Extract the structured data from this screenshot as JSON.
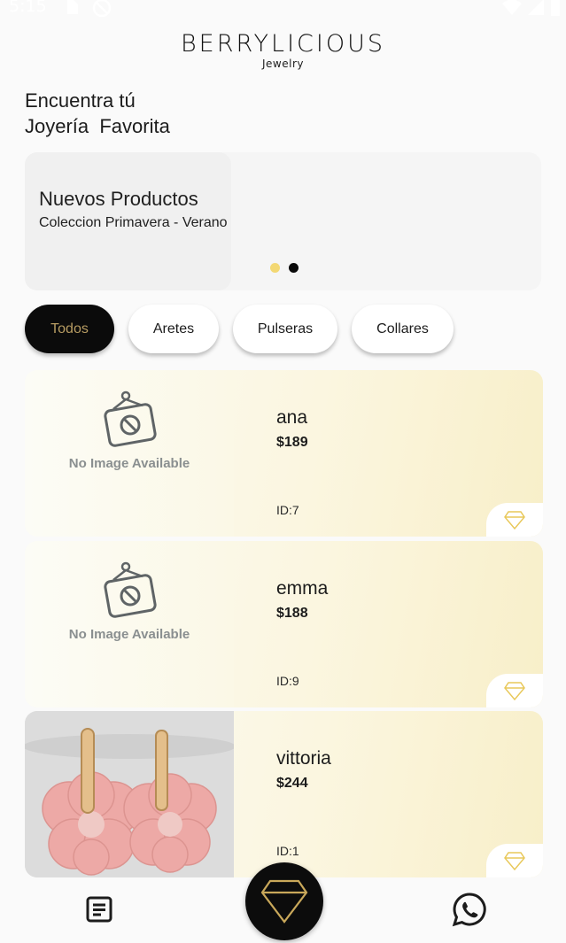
{
  "status": {
    "time": "5:15"
  },
  "brand": {
    "name": "BERRYLICIOUS",
    "sub": "Jewelry"
  },
  "headline": {
    "line1": "Encuentra tú",
    "line2": "Joyería  Favorita"
  },
  "banner": {
    "title": "Nuevos Productos",
    "subtitle": "Coleccion Primavera - Verano",
    "dots": {
      "active_color": "#f3d873",
      "inactive_color": "#0a0a0a"
    }
  },
  "categories": [
    {
      "label": "Todos",
      "active": true
    },
    {
      "label": "Aretes",
      "active": false
    },
    {
      "label": "Pulseras",
      "active": false
    },
    {
      "label": "Collares",
      "active": false
    }
  ],
  "products": [
    {
      "name": "ana",
      "price": "$189",
      "id": "ID:7",
      "image": "no-image",
      "no_image_label": "No Image Available"
    },
    {
      "name": "emma",
      "price": "$188",
      "id": "ID:9",
      "image": "no-image",
      "no_image_label": "No Image Available"
    },
    {
      "name": "vittoria",
      "price": "$244",
      "id": "ID:1",
      "image": "pink-flower-earrings-photo"
    }
  ],
  "bottom_nav": {
    "left_icon": "list-document-icon",
    "center_icon": "diamond-icon",
    "right_icon": "whatsapp-icon"
  },
  "colors": {
    "accent_gold": "#b79c62",
    "chip_active_bg": "#0b0b0b",
    "card_gradient_end": "#f8efc9"
  }
}
